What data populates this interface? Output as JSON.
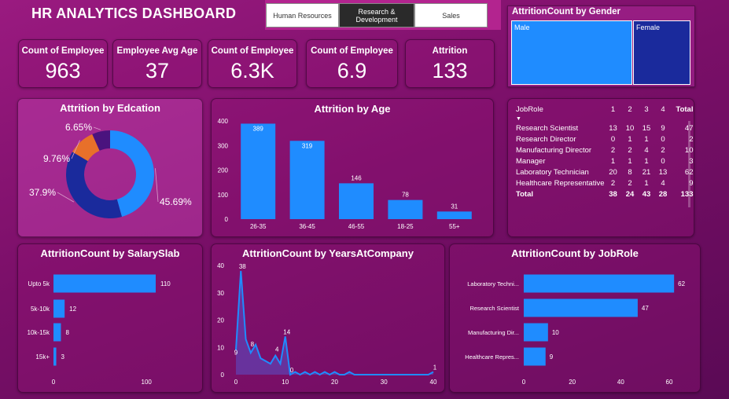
{
  "dashboard_title": "HR ANALYTICS DASHBOARD",
  "slicer": {
    "items": [
      "Human Resources",
      "Research & Development",
      "Sales"
    ],
    "selected": "Research & Development"
  },
  "kpis": [
    {
      "label": "Count of Employee",
      "value": "963"
    },
    {
      "label": "Employee Avg Age",
      "value": "37"
    },
    {
      "label": "Count of Employee",
      "value": "6.3K"
    },
    {
      "label": "Count of Employee",
      "value": "6.9"
    },
    {
      "label": "Attrition",
      "value": "133"
    }
  ],
  "colors": {
    "bar": "#1f8cff",
    "navy": "#1a2a9c",
    "purple": "#4a137e",
    "orange": "#e8702a"
  },
  "chart_data": [
    {
      "id": "gender",
      "type": "treemap",
      "title": "AttritionCount by Gender",
      "categories": [
        "Male",
        "Female"
      ]
    },
    {
      "id": "education",
      "type": "pie",
      "title": "Attrition by Edcation",
      "data_labels": [
        "45.69%",
        "37.9%",
        "9.76%",
        "6.65%"
      ],
      "values": [
        45.69,
        37.9,
        9.76,
        6.65
      ]
    },
    {
      "id": "age",
      "type": "bar",
      "title": "Attrition by Age",
      "categories": [
        "26-35",
        "36-45",
        "46-55",
        "18-25",
        "55+"
      ],
      "values": [
        389,
        319,
        146,
        78,
        31
      ],
      "ylim": [
        0,
        400
      ],
      "yticks": [
        0,
        100,
        200,
        300,
        400
      ]
    },
    {
      "id": "salary",
      "type": "bar",
      "title": "AttritionCount by SalarySlab",
      "categories": [
        "Upto 5k",
        "5k-10k",
        "10k-15k",
        "15k+"
      ],
      "values": [
        110,
        12,
        8,
        3
      ],
      "xticks": [
        0,
        100
      ]
    },
    {
      "id": "years",
      "type": "area",
      "title": "AttritionCount by YearsAtCompany",
      "x": [
        0,
        1,
        2,
        3,
        4,
        5,
        6,
        7,
        8,
        9,
        10,
        11,
        12,
        13,
        14,
        15,
        16,
        17,
        18,
        19,
        20,
        21,
        22,
        23,
        24,
        25,
        26,
        27,
        28,
        29,
        30,
        31,
        32,
        33,
        34,
        35,
        36,
        37,
        38,
        39,
        40
      ],
      "y": [
        9,
        38,
        13,
        8,
        11,
        6,
        5,
        4,
        7,
        4,
        14,
        0,
        1,
        0,
        1,
        0,
        1,
        0,
        1,
        0,
        1,
        0,
        0,
        1,
        0,
        0,
        0,
        0,
        0,
        0,
        0,
        0,
        0,
        0,
        0,
        0,
        0,
        0,
        0,
        0,
        1
      ],
      "data_labels": [
        {
          "x": 0,
          "text": "9"
        },
        {
          "x": 1,
          "text": "38"
        },
        {
          "x": 3,
          "text": "8"
        },
        {
          "x": 8,
          "text": "4"
        },
        {
          "x": 10,
          "text": "14"
        },
        {
          "x": 11,
          "text": "0"
        },
        {
          "x": 40,
          "text": "1"
        }
      ],
      "ylim": [
        0,
        40
      ],
      "yticks": [
        0,
        10,
        20,
        30,
        40
      ],
      "xticks": [
        0,
        10,
        20,
        30,
        40
      ]
    },
    {
      "id": "jobrole",
      "type": "bar",
      "title": "AttritionCount by JobRole",
      "categories": [
        "Laboratory Techni...",
        "Research Scientist",
        "Manufacturing Dir...",
        "Healthcare Repres..."
      ],
      "values": [
        62,
        47,
        10,
        9
      ],
      "xticks": [
        0,
        20,
        40,
        60
      ]
    }
  ],
  "table": {
    "headers": [
      "JobRole",
      "1",
      "2",
      "3",
      "4",
      "Total"
    ],
    "rows": [
      [
        "Research Scientist",
        "13",
        "10",
        "15",
        "9",
        "47"
      ],
      [
        "Research Director",
        "0",
        "1",
        "1",
        "0",
        "2"
      ],
      [
        "Manufacturing Director",
        "2",
        "2",
        "4",
        "2",
        "10"
      ],
      [
        "Manager",
        "1",
        "1",
        "1",
        "0",
        "3"
      ],
      [
        "Laboratory Technician",
        "20",
        "8",
        "21",
        "13",
        "62"
      ],
      [
        "Healthcare Representative",
        "2",
        "2",
        "1",
        "4",
        "9"
      ]
    ],
    "total": [
      "Total",
      "38",
      "24",
      "43",
      "28",
      "133"
    ]
  }
}
